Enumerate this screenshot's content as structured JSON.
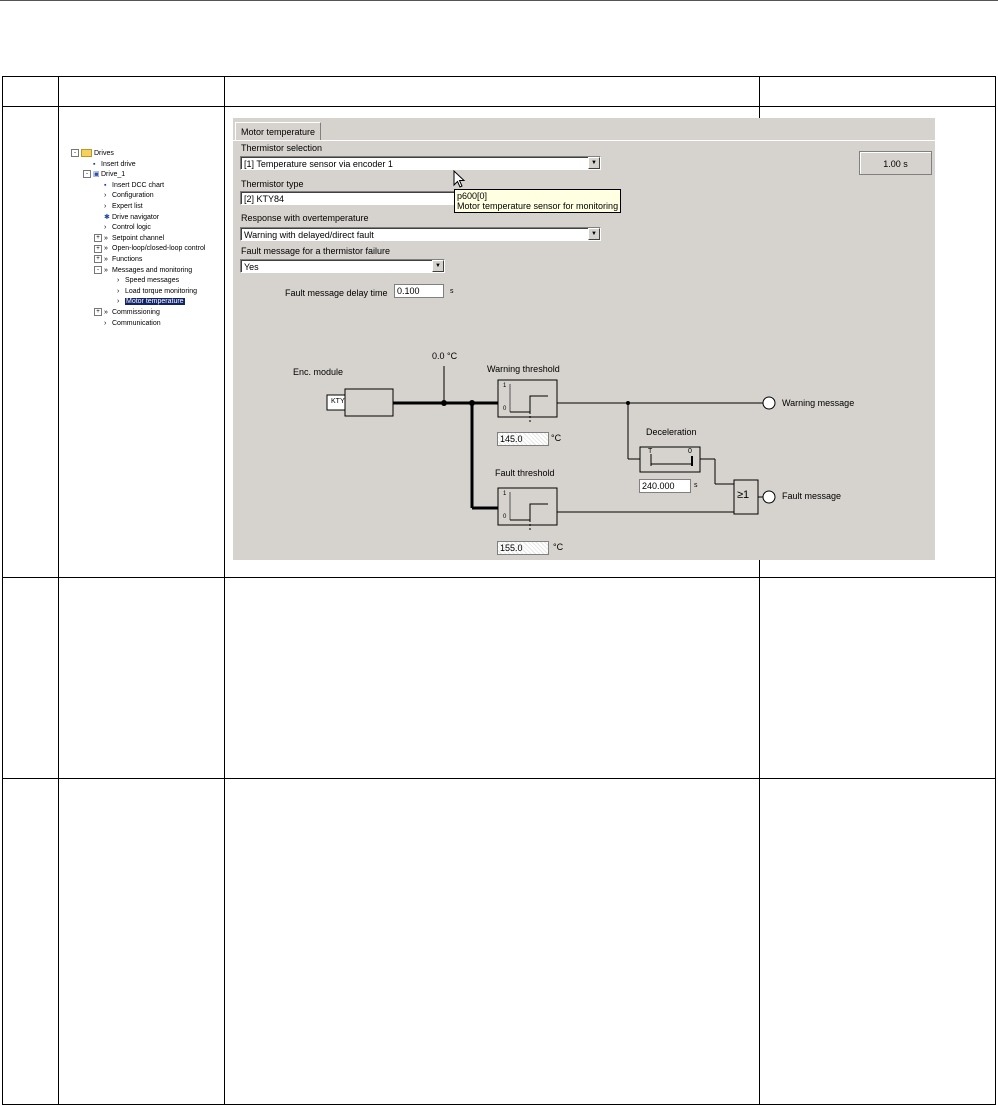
{
  "tree": {
    "items": [
      {
        "label": "Drives",
        "indent": 0,
        "exp": "-",
        "icon": "folder"
      },
      {
        "label": "Insert drive",
        "indent": 1,
        "icon": "insert"
      },
      {
        "label": "Drive_1",
        "indent": 1,
        "exp": "-",
        "icon": "drive"
      },
      {
        "label": "Insert DCC chart",
        "indent": 2,
        "icon": "insert"
      },
      {
        "label": "Configuration",
        "indent": 2,
        "icon": "chev"
      },
      {
        "label": "Expert list",
        "indent": 2,
        "icon": "chev"
      },
      {
        "label": "Drive navigator",
        "indent": 2,
        "icon": "nav"
      },
      {
        "label": "Control logic",
        "indent": 2,
        "icon": "chev"
      },
      {
        "label": "Setpoint channel",
        "indent": 2,
        "exp": "+",
        "icon": "dchev"
      },
      {
        "label": "Open-loop/closed-loop control",
        "indent": 2,
        "exp": "+",
        "icon": "dchev"
      },
      {
        "label": "Functions",
        "indent": 2,
        "exp": "+",
        "icon": "dchev"
      },
      {
        "label": "Messages and monitoring",
        "indent": 2,
        "exp": "-",
        "icon": "dchev"
      },
      {
        "label": "Speed messages",
        "indent": 3,
        "icon": "chev"
      },
      {
        "label": "Load torque monitoring",
        "indent": 3,
        "icon": "chev"
      },
      {
        "label": "Motor temperature",
        "indent": 3,
        "icon": "chev",
        "selected": true
      },
      {
        "label": "Commissioning",
        "indent": 2,
        "exp": "+",
        "icon": "dchev"
      },
      {
        "label": "Communication",
        "indent": 2,
        "icon": "chev"
      }
    ]
  },
  "panel": {
    "tab": "Motor temperature",
    "thermistor_selection_label": "Thermistor selection",
    "thermistor_selection_value": "[1] Temperature sensor via encoder 1",
    "thermistor_type_label": "Thermistor type",
    "thermistor_type_value": "[2] KTY84",
    "response_label": "Response with overtemperature",
    "response_value": "Warning with delayed/direct fault",
    "fault_msg_label": "Fault message for a thermistor failure",
    "fault_msg_value": "Yes",
    "delay_label": "Fault message delay time",
    "delay_value": "0.100",
    "delay_unit": "s",
    "time_button": "1.00 s",
    "tooltip_line1": "p600[0]",
    "tooltip_line2": "Motor temperature sensor for monitoring"
  },
  "diagram": {
    "enc_module": "Enc. module",
    "kty": "KTY",
    "temp_readout": "0.0 °C",
    "warning_threshold_label": "Warning threshold",
    "warning_threshold_value": "145.0",
    "fault_threshold_label": "Fault threshold",
    "fault_threshold_value": "155.0",
    "unit_c": "°C",
    "deceleration_label": "Deceleration",
    "deceleration_value": "240.000",
    "unit_s": "s",
    "warning_message": "Warning message",
    "fault_message": "Fault message",
    "or_gate": "≥1",
    "t_label": "T",
    "zero": "0",
    "one": "1"
  }
}
